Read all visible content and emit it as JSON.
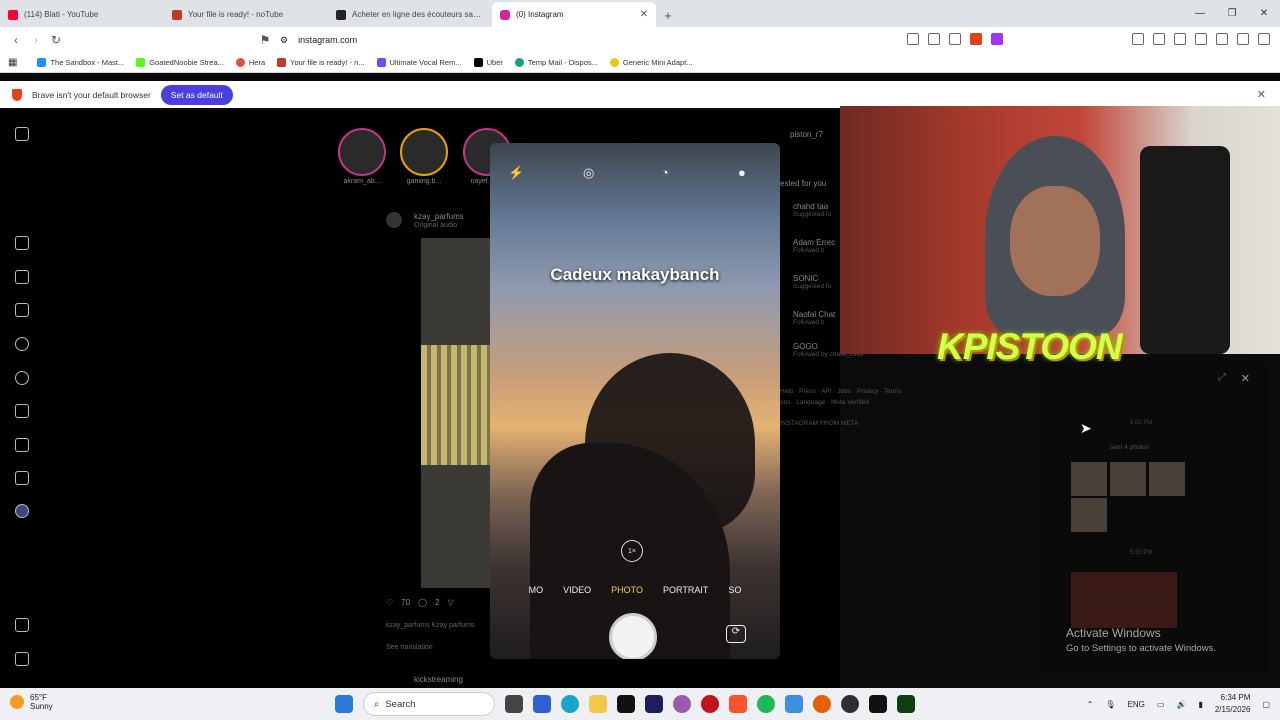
{
  "tabs": [
    {
      "title": "(114) Blati - YouTube",
      "color": "#ff0033"
    },
    {
      "title": "Your file is ready! - noTube",
      "color": "#c0392b"
    },
    {
      "title": "Acheter en ligne des écouteurs sans fil",
      "color": "#222222"
    },
    {
      "title": "(0) Instagram",
      "color": "#d6249f"
    }
  ],
  "address": {
    "url": "instagram.com"
  },
  "bookmarks": [
    {
      "label": "The Sandbox - Mast...",
      "color": "#1e90ff"
    },
    {
      "label": "GoatedNoobie Strea...",
      "color": "#53fc18"
    },
    {
      "label": "Hera",
      "color": "#e74c3c"
    },
    {
      "label": "Your file is ready! - n...",
      "color": "#c0392b"
    },
    {
      "label": "Ultimate Vocal Rem...",
      "color": "#6b4dff"
    },
    {
      "label": "Uber",
      "color": "#000000"
    },
    {
      "label": "Temp Mail - Dispos...",
      "color": "#16a085"
    },
    {
      "label": "Generic Mini Adapt...",
      "color": "#f1c40f"
    }
  ],
  "infobar": {
    "message": "Brave isn't your default browser",
    "button": "Set as default"
  },
  "stories": [
    {
      "label": "akram_ab..."
    },
    {
      "label": "gaming.b..."
    },
    {
      "label": "nayef..."
    }
  ],
  "post": {
    "user": "kzay_parfums",
    "subtitle": "Original audio",
    "likes": "70",
    "comments": "2",
    "caption": "kzay_parfums Kzay parfums",
    "see": "See translation",
    "next_user": "kickstreaming"
  },
  "camera": {
    "overlay_text": "Cadeux makaybanch",
    "zoom": "1×",
    "modes": [
      "MO",
      "VIDEO",
      "PHOTO",
      "PORTRAIT",
      "SO"
    ],
    "active_mode": "PHOTO"
  },
  "sidebar": {
    "profile": "piston_r7",
    "suggested_header": "ested for you",
    "suggestions": [
      {
        "name": "chahd taa",
        "sub": "Suggested fo"
      },
      {
        "name": "Adam Errec",
        "sub": "Followed b"
      },
      {
        "name": "SONIC",
        "sub": "Suggested fo"
      },
      {
        "name": "Naofal Chat",
        "sub": "Followed b"
      },
      {
        "name": "GOGO",
        "sub": "Followed by chafik_zxtbl"
      }
    ],
    "footer": "Help · Press · API · Jobs · Privacy · Terms",
    "footer2": "ons · Language · Meta Verified",
    "copyright": "INSTAGRAM FROM META"
  },
  "stream": {
    "brand": "KPISTOON"
  },
  "dm": {
    "time1": "5:02 PM",
    "sent": "sent 4 photos",
    "time2": "5:33 PM"
  },
  "activate": {
    "line1": "Activate Windows",
    "line2": "Go to Settings to activate Windows."
  },
  "taskbar": {
    "temp": "65°F",
    "condition": "Sunny",
    "search": "Search",
    "lang": "ENG",
    "time": "6:34 PM",
    "date": "2/15/2026"
  }
}
